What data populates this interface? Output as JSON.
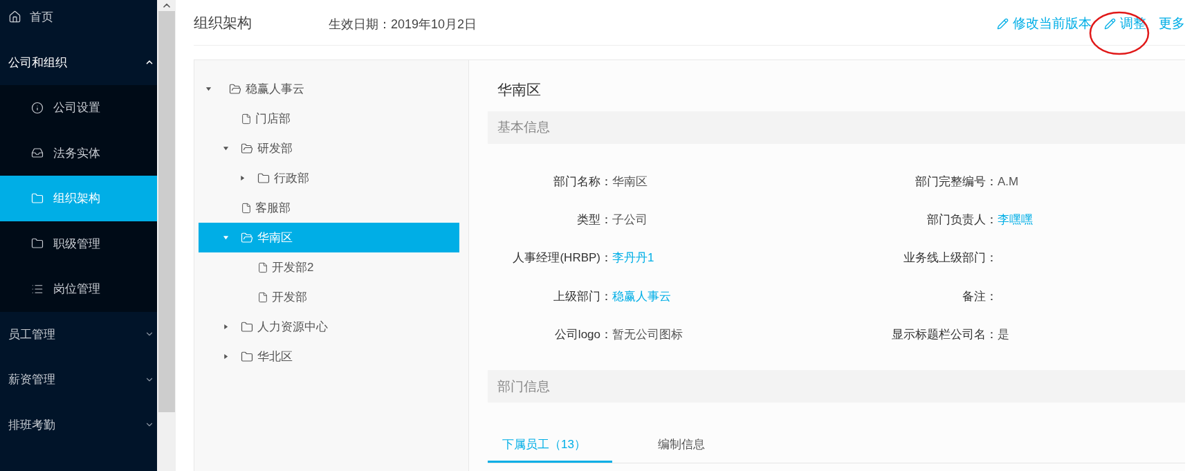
{
  "sidebar": {
    "items": [
      {
        "label": "首页",
        "kind": "home",
        "selected": false
      },
      {
        "label": "公司和组织",
        "expanded": true,
        "selected": false,
        "children": [
          {
            "label": "公司设置",
            "kind": "info",
            "selected": false
          },
          {
            "label": "法务实体",
            "kind": "inbox",
            "selected": false
          },
          {
            "label": "组织架构",
            "kind": "folder",
            "selected": true
          },
          {
            "label": "职级管理",
            "kind": "folder",
            "selected": false
          },
          {
            "label": "岗位管理",
            "kind": "list",
            "selected": false
          }
        ]
      },
      {
        "label": "员工管理",
        "expanded": false,
        "selected": false
      },
      {
        "label": "薪资管理",
        "expanded": false,
        "selected": false
      },
      {
        "label": "排班考勤",
        "expanded": false,
        "selected": false
      }
    ]
  },
  "header": {
    "title": "组织架构",
    "effective_date": "生效日期：2019年10月2日",
    "actions": [
      "修改当前版本",
      "调整",
      "更多"
    ]
  },
  "tree": [
    {
      "label": "稳赢人事云",
      "kind": "folder",
      "expanded": true,
      "selected": false,
      "children": [
        {
          "label": "门店部",
          "kind": "file",
          "selected": false
        },
        {
          "label": "研发部",
          "kind": "folder",
          "expanded": true,
          "selected": false,
          "children": [
            {
              "label": "行政部",
              "kind": "folder",
              "expanded": false,
              "selected": false
            }
          ]
        },
        {
          "label": "客服部",
          "kind": "file",
          "selected": false
        },
        {
          "label": "华南区",
          "kind": "folder",
          "expanded": true,
          "selected": true,
          "children": [
            {
              "label": "开发部2",
              "kind": "file",
              "selected": false
            },
            {
              "label": "开发部",
              "kind": "file",
              "selected": false
            }
          ]
        },
        {
          "label": "人力资源中心",
          "kind": "folder",
          "expanded": false,
          "selected": false
        },
        {
          "label": "华北区",
          "kind": "folder",
          "expanded": false,
          "selected": false
        }
      ]
    }
  ],
  "detail": {
    "title": "华南区",
    "basic_section": "基本信息",
    "fields": [
      {
        "label": "部门名称：",
        "value": "华南区",
        "kind": "text"
      },
      {
        "label": "部门完整编号：",
        "value": "A.M",
        "kind": "text"
      },
      {
        "label": "类型：",
        "value": "子公司",
        "kind": "text"
      },
      {
        "label": "部门负责人：",
        "value": "李嘿嘿",
        "kind": "link"
      },
      {
        "label": "人事经理(HRBP)：",
        "value": "李丹丹1",
        "kind": "link"
      },
      {
        "label": "业务线上级部门："
      },
      {
        "label": "上级部门：",
        "value": "稳赢人事云",
        "kind": "link"
      },
      {
        "label": "备注："
      },
      {
        "label": "公司logo：",
        "value": "暂无公司图标",
        "kind": "text"
      },
      {
        "label": "显示标题栏公司名：",
        "value": "是",
        "kind": "text"
      }
    ],
    "dept_section": "部门信息",
    "tabs": [
      {
        "label": "下属员工（13）",
        "selected": true
      },
      {
        "label": "编制信息",
        "selected": false
      }
    ]
  }
}
